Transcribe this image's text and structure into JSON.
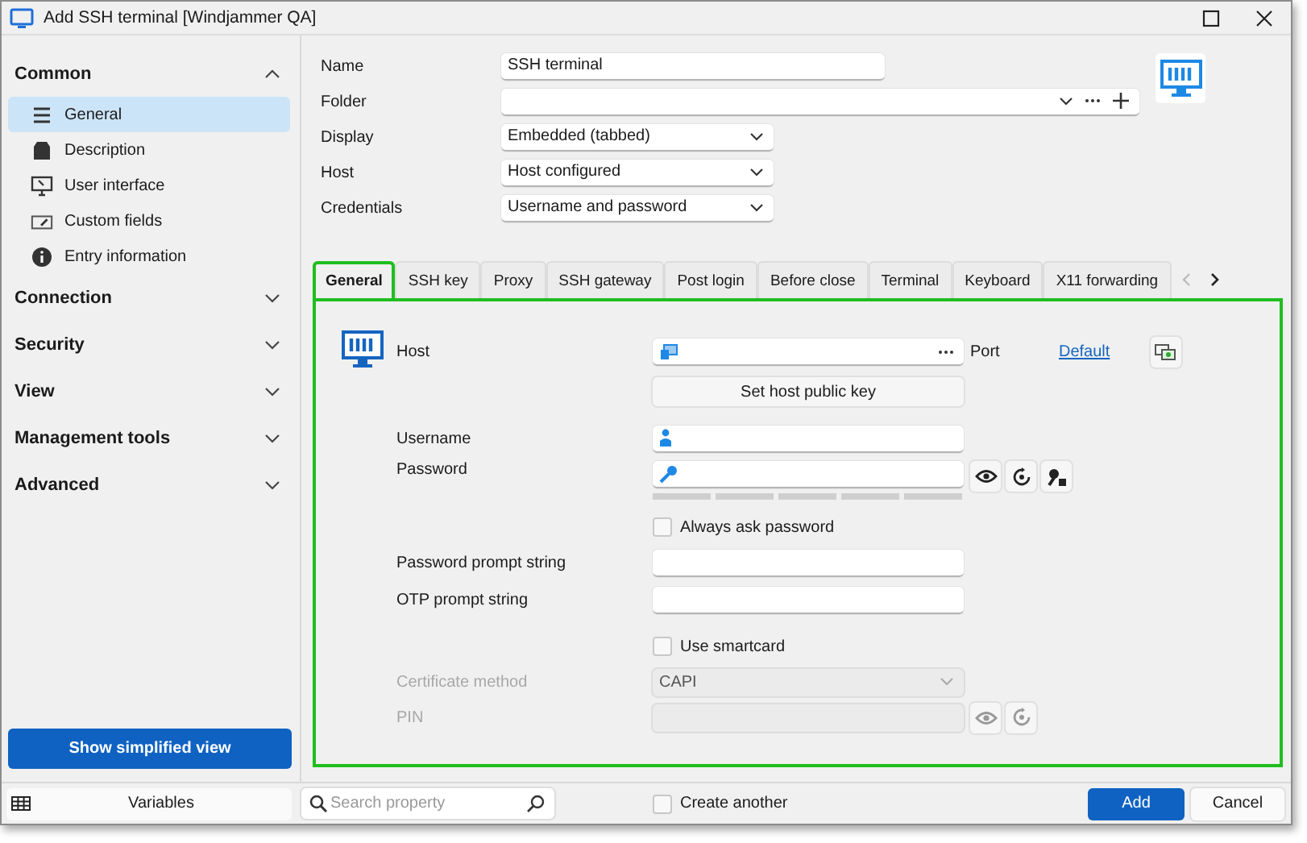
{
  "window": {
    "title": "Add SSH terminal [Windjammer QA]"
  },
  "sidebar": {
    "sections": [
      {
        "label": "Common",
        "expanded": true,
        "items": [
          {
            "label": "General",
            "selected": true
          },
          {
            "label": "Description",
            "selected": false
          },
          {
            "label": "User interface",
            "selected": false
          },
          {
            "label": "Custom fields",
            "selected": false
          },
          {
            "label": "Entry information",
            "selected": false
          }
        ]
      },
      {
        "label": "Connection",
        "expanded": false
      },
      {
        "label": "Security",
        "expanded": false
      },
      {
        "label": "View",
        "expanded": false
      },
      {
        "label": "Management tools",
        "expanded": false
      },
      {
        "label": "Advanced",
        "expanded": false
      }
    ],
    "simplified_button": "Show simplified view"
  },
  "entry_form": [
    {
      "kind": "text",
      "label": "Name",
      "value": "SSH terminal"
    },
    {
      "kind": "folder",
      "label": "Folder"
    },
    {
      "kind": "select",
      "label": "Display",
      "value": "Embedded (tabbed)"
    },
    {
      "kind": "select",
      "label": "Host",
      "value": "Host configured"
    },
    {
      "kind": "select",
      "label": "Credentials",
      "value": "Username and password"
    }
  ],
  "tabs": [
    {
      "label": "General",
      "selected": true
    },
    {
      "label": "SSH key",
      "selected": false
    },
    {
      "label": "Proxy",
      "selected": false
    },
    {
      "label": "SSH gateway",
      "selected": false
    },
    {
      "label": "Post login",
      "selected": false
    },
    {
      "label": "Before close",
      "selected": false
    },
    {
      "label": "Terminal",
      "selected": false
    },
    {
      "label": "Keyboard",
      "selected": false
    },
    {
      "label": "X11 forwarding",
      "selected": false
    }
  ],
  "general_panel": [
    {
      "kind": "host",
      "label": "Host",
      "port_label": "Port",
      "port_link": "Default"
    },
    {
      "kind": "button",
      "label": "Set host public key"
    },
    {
      "kind": "username",
      "label": "Username"
    },
    {
      "kind": "password",
      "label": "Password"
    },
    {
      "kind": "checkbox",
      "label": "Always ask password",
      "checked": false
    },
    {
      "kind": "text",
      "label": "Password prompt string"
    },
    {
      "kind": "text",
      "label": "OTP prompt string"
    },
    {
      "kind": "checkbox",
      "label": "Use smartcard",
      "checked": false
    },
    {
      "kind": "select",
      "label": "Certificate method",
      "value": "CAPI",
      "disabled": true
    },
    {
      "kind": "pin",
      "label": "PIN",
      "disabled": true
    }
  ],
  "footer": {
    "variables": "Variables",
    "search_placeholder": "Search property",
    "create_another": {
      "label": "Create another",
      "checked": false
    },
    "buttons": [
      {
        "label": "Add",
        "kind": "primary"
      },
      {
        "label": "Cancel",
        "kind": "secondary"
      }
    ]
  }
}
